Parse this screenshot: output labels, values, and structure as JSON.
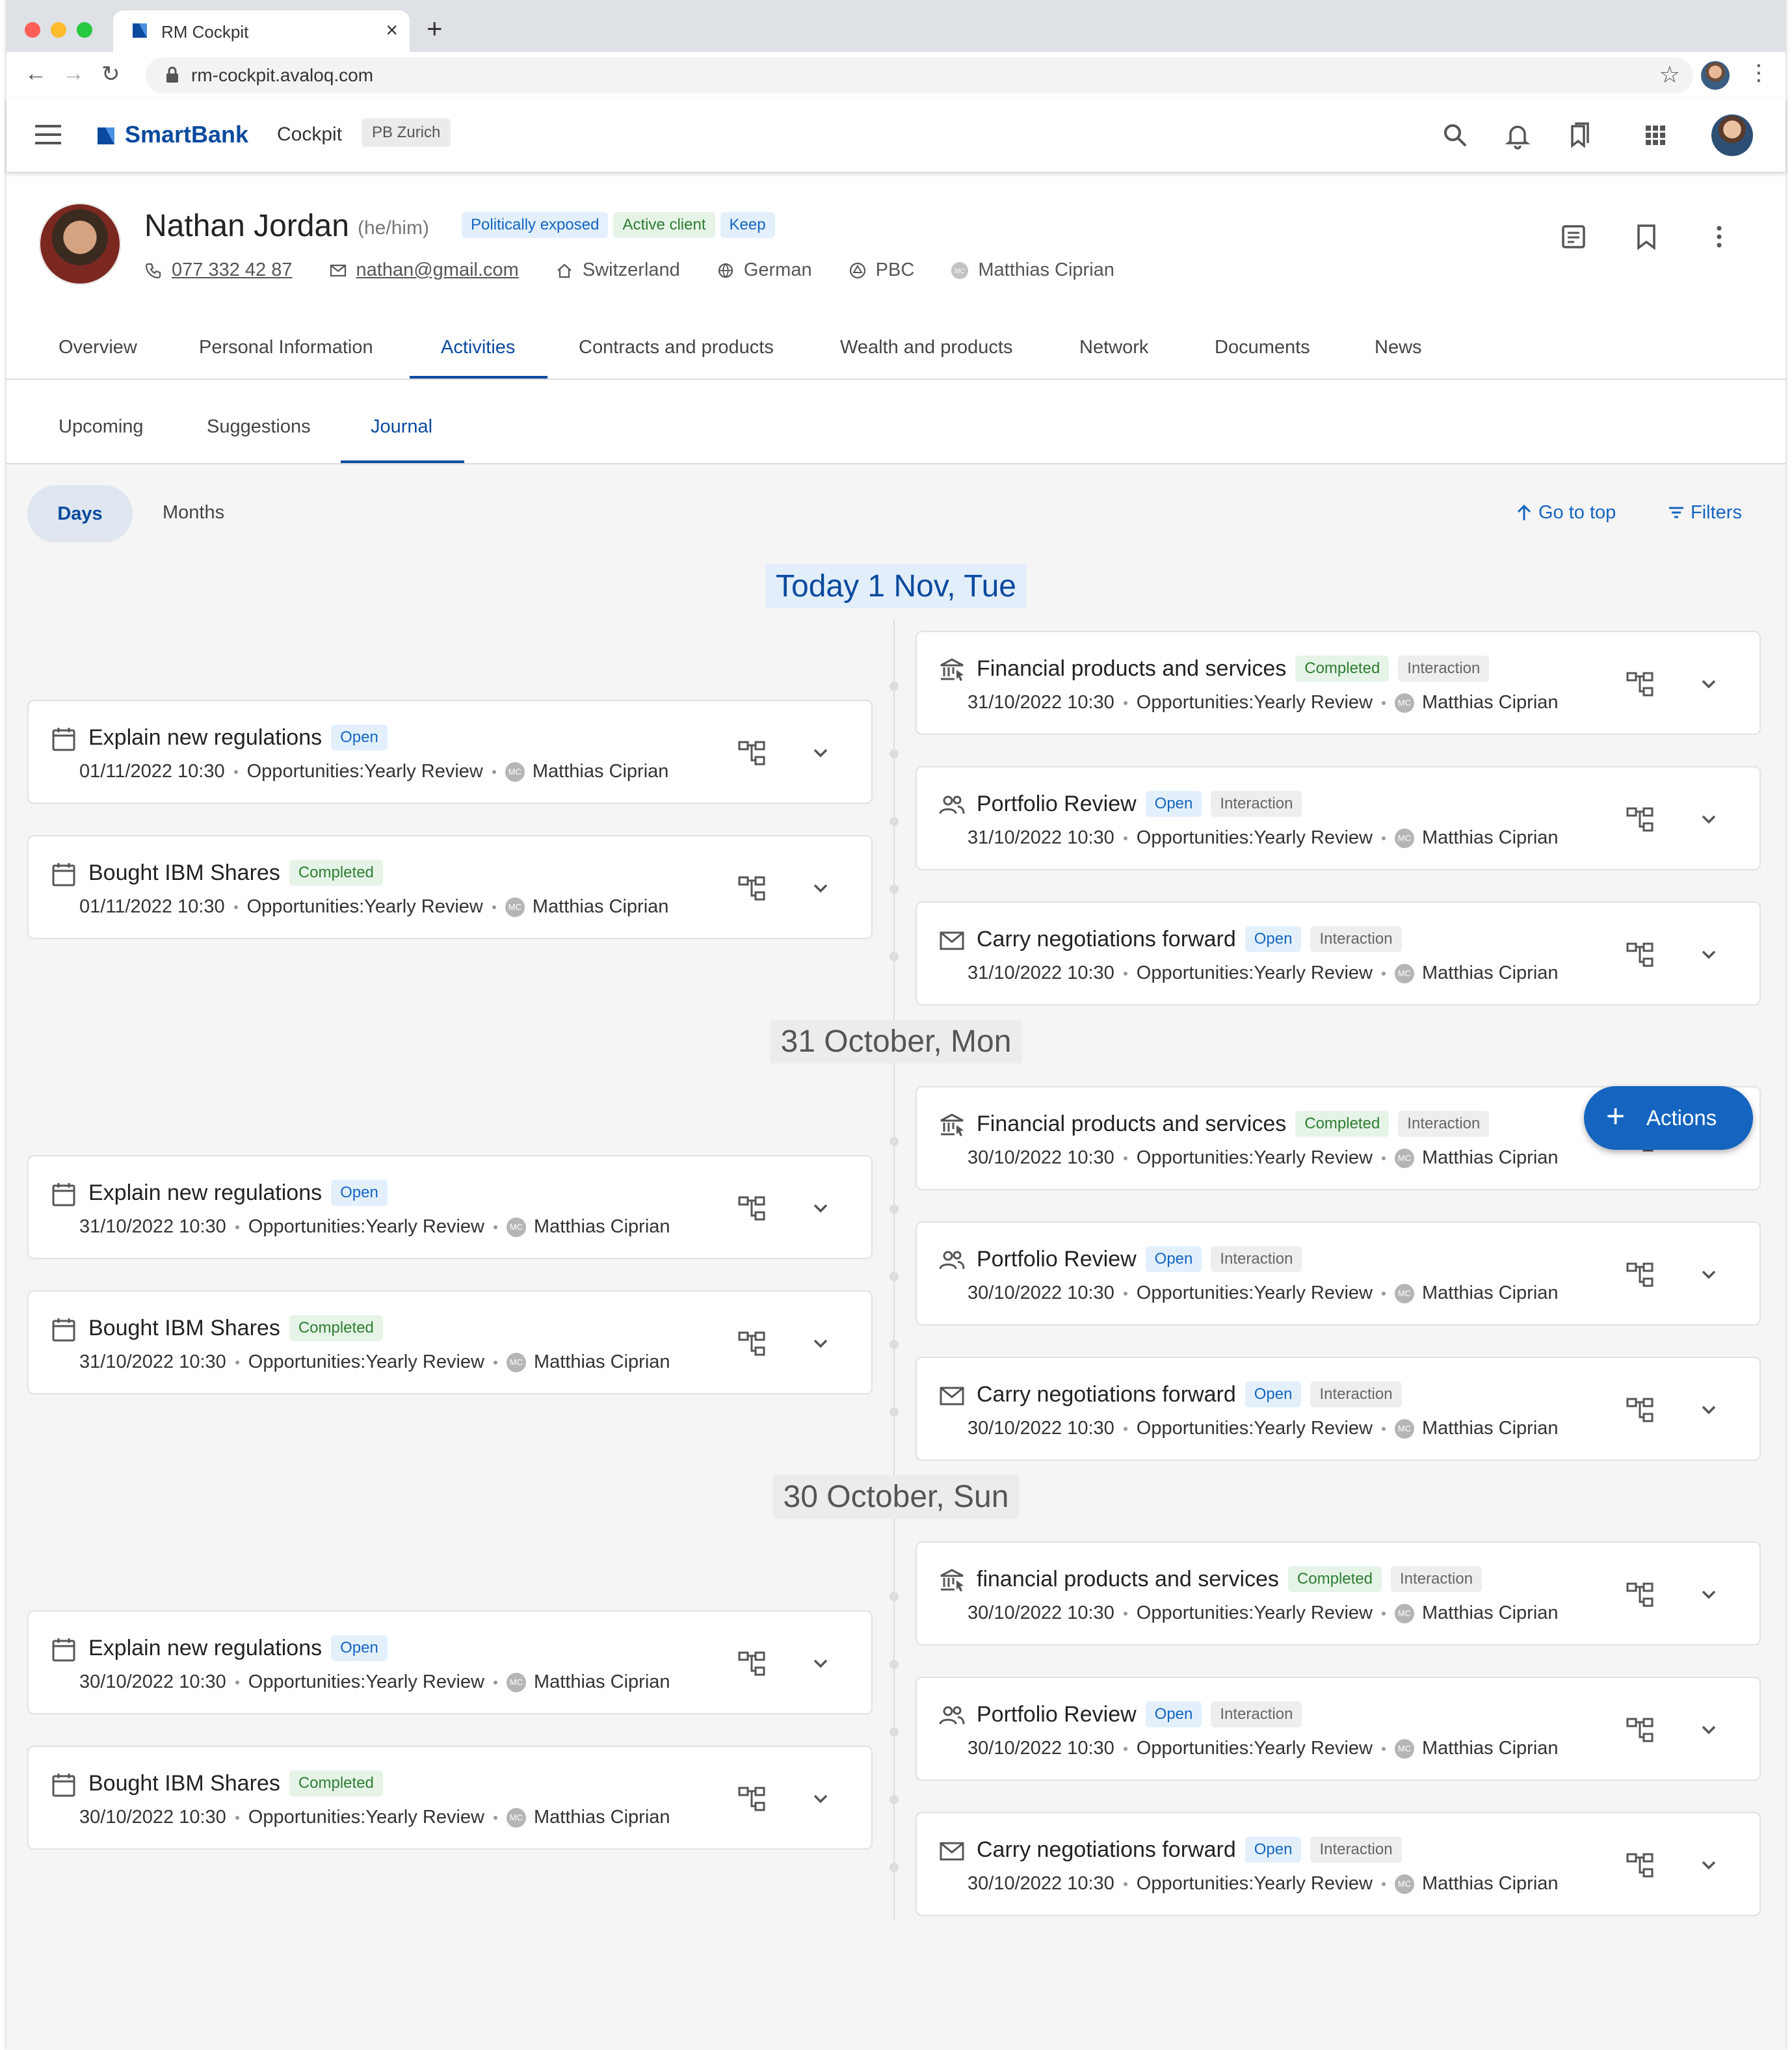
{
  "browser": {
    "tab_title": "RM Cockpit",
    "url": "rm-cockpit.avaloq.com"
  },
  "app": {
    "brand": "SmartBank",
    "module": "Cockpit",
    "location": "PB Zurich"
  },
  "client": {
    "name": "Nathan Jordan",
    "pronouns": "(he/him)",
    "badges": [
      "Politically exposed",
      "Active client",
      "Keep"
    ],
    "phone": "077 332 42 87",
    "email": "nathan@gmail.com",
    "country": "Switzerland",
    "language": "German",
    "segment": "PBC",
    "advisor": "Matthias Ciprian"
  },
  "tabs": [
    "Overview",
    "Personal Information",
    "Activities",
    "Contracts and products",
    "Wealth and products",
    "Network",
    "Documents",
    "News"
  ],
  "subtabs": [
    "Upcoming",
    "Suggestions",
    "Journal"
  ],
  "journal": {
    "toggle_days": "Days",
    "toggle_months": "Months",
    "go_to_top": "Go to top",
    "filters": "Filters",
    "fab_label": "Actions"
  },
  "groups": [
    {
      "date": "Today  1 Nov, Tue",
      "left": [
        {
          "title": "Explain new regulations",
          "status": "Open",
          "date": "01/11/2022 10:30",
          "topic": "Opportunities:Yearly Review",
          "owner": "Matthias Ciprian",
          "icon": "calendar-icon"
        },
        {
          "title": "Bought IBM Shares",
          "status": "Completed",
          "date": "01/11/2022 10:30",
          "topic": "Opportunities:Yearly Review",
          "owner": "Matthias Ciprian",
          "icon": "calendar-icon"
        }
      ],
      "right": [
        {
          "title": "Financial products and services",
          "status": "Completed",
          "type": "Interaction",
          "date": "31/10/2022 10:30",
          "topic": "Opportunities:Yearly Review",
          "owner": "Matthias Ciprian",
          "icon": "bank-icon"
        },
        {
          "title": "Portfolio Review",
          "status": "Open",
          "type": "Interaction",
          "date": "31/10/2022 10:30",
          "topic": "Opportunities:Yearly Review",
          "owner": "Matthias Ciprian",
          "icon": "people-icon"
        },
        {
          "title": "Carry negotiations forward",
          "status": "Open",
          "type": "Interaction",
          "date": "31/10/2022 10:30",
          "topic": "Opportunities:Yearly Review",
          "owner": "Matthias Ciprian",
          "icon": "mail-icon"
        }
      ]
    },
    {
      "date": "31 October, Mon",
      "left": [
        {
          "title": "Explain new regulations",
          "status": "Open",
          "date": "31/10/2022 10:30",
          "topic": "Opportunities:Yearly Review",
          "owner": "Matthias Ciprian",
          "icon": "calendar-icon"
        },
        {
          "title": "Bought IBM Shares",
          "status": "Completed",
          "date": "31/10/2022 10:30",
          "topic": "Opportunities:Yearly Review",
          "owner": "Matthias Ciprian",
          "icon": "calendar-icon"
        }
      ],
      "right": [
        {
          "title": "Financial products and services",
          "status": "Completed",
          "type": "Interaction",
          "date": "30/10/2022 10:30",
          "topic": "Opportunities:Yearly Review",
          "owner": "Matthias Ciprian",
          "icon": "bank-icon"
        },
        {
          "title": "Portfolio Review",
          "status": "Open",
          "type": "Interaction",
          "date": "30/10/2022 10:30",
          "topic": "Opportunities:Yearly Review",
          "owner": "Matthias Ciprian",
          "icon": "people-icon"
        },
        {
          "title": "Carry negotiations forward",
          "status": "Open",
          "type": "Interaction",
          "date": "30/10/2022 10:30",
          "topic": "Opportunities:Yearly Review",
          "owner": "Matthias Ciprian",
          "icon": "mail-icon"
        }
      ]
    },
    {
      "date": "30 October, Sun",
      "left": [
        {
          "title": "Explain new regulations",
          "status": "Open",
          "date": "30/10/2022 10:30",
          "topic": "Opportunities:Yearly Review",
          "owner": "Matthias Ciprian",
          "icon": "calendar-icon"
        },
        {
          "title": "Bought IBM Shares",
          "status": "Completed",
          "date": "30/10/2022 10:30",
          "topic": "Opportunities:Yearly Review",
          "owner": "Matthias Ciprian",
          "icon": "calendar-icon"
        }
      ],
      "right": [
        {
          "title": "financial products and services",
          "status": "Completed",
          "type": "Interaction",
          "date": "30/10/2022 10:30",
          "topic": "Opportunities:Yearly Review",
          "owner": "Matthias Ciprian",
          "icon": "bank-icon"
        },
        {
          "title": "Portfolio Review",
          "status": "Open",
          "type": "Interaction",
          "date": "30/10/2022 10:30",
          "topic": "Opportunities:Yearly Review",
          "owner": "Matthias Ciprian",
          "icon": "people-icon"
        },
        {
          "title": "Carry negotiations forward",
          "status": "Open",
          "type": "Interaction",
          "date": "30/10/2022 10:30",
          "topic": "Opportunities:Yearly Review",
          "owner": "Matthias Ciprian",
          "icon": "mail-icon"
        }
      ]
    }
  ],
  "colors": {
    "brand": "#0a4a9e",
    "accent": "#1565c0",
    "open_bg": "#e3f0fc",
    "completed_bg": "#e6f4e8"
  }
}
